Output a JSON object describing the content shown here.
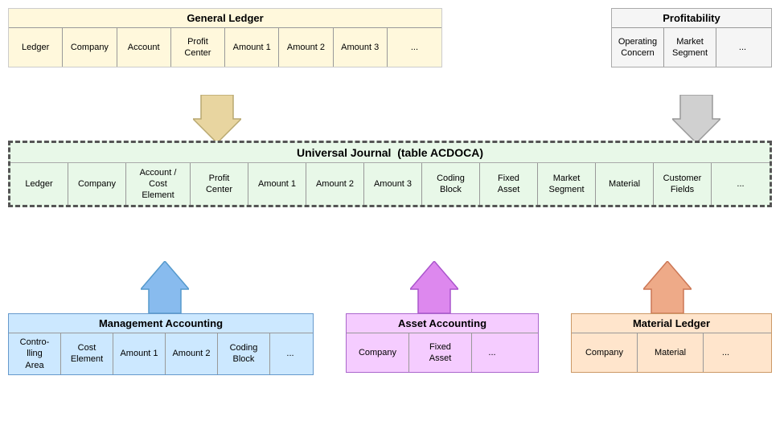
{
  "generalLedger": {
    "title": "General Ledger",
    "columns": [
      "Ledger",
      "Company",
      "Account",
      "Profit\nCenter",
      "Amount 1",
      "Amount 2",
      "Amount 3",
      "..."
    ]
  },
  "profitability": {
    "title": "Profitability",
    "columns": [
      "Operating\nConcern",
      "Market\nSegment",
      "..."
    ]
  },
  "universalJournal": {
    "title": "Universal Journal",
    "subtitle": "(table ACDOCA)",
    "columns": [
      "Ledger",
      "Company",
      "Account /\nCost\nElement",
      "Profit\nCenter",
      "Amount 1",
      "Amount 2",
      "Amount 3",
      "Coding\nBlock",
      "Fixed\nAsset",
      "Market\nSegment",
      "Material",
      "Customer\nFields",
      "..."
    ]
  },
  "managementAccounting": {
    "title": "Management Accounting",
    "columns": [
      "Contro-\nling\nArea",
      "Cost\nElement",
      "Amount 1",
      "Amount 2",
      "Coding\nBlock",
      "..."
    ]
  },
  "assetAccounting": {
    "title": "Asset Accounting",
    "columns": [
      "Company",
      "Fixed\nAsset",
      "..."
    ]
  },
  "materialLedger": {
    "title": "Material Ledger",
    "columns": [
      "Company",
      "Material",
      "..."
    ]
  }
}
